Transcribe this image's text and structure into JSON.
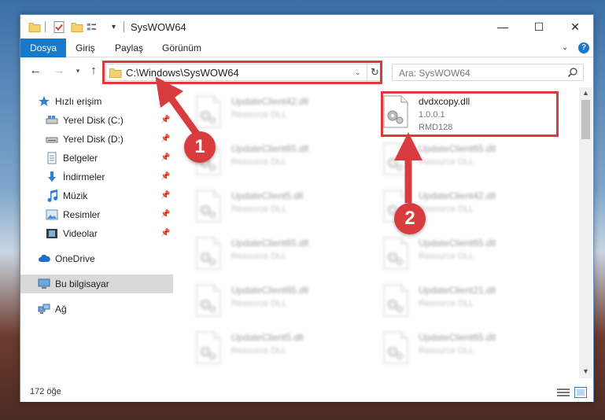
{
  "window": {
    "title": "SysWOW64",
    "minimize": "—",
    "maximize": "☐",
    "close": "✕"
  },
  "ribbon": {
    "tabs": [
      {
        "label": "Dosya"
      },
      {
        "label": "Giriş"
      },
      {
        "label": "Paylaş"
      },
      {
        "label": "Görünüm"
      }
    ],
    "help": "?"
  },
  "address": {
    "path": "C:\\Windows\\SysWOW64"
  },
  "search": {
    "placeholder": "Ara: SysWOW64"
  },
  "sidebar": {
    "items": [
      {
        "label": "Hızlı erişim",
        "icon": "star-icon"
      },
      {
        "label": "Yerel Disk (C:)",
        "icon": "drive-icon",
        "pinned": true
      },
      {
        "label": "Yerel Disk (D:)",
        "icon": "drive-icon",
        "pinned": true
      },
      {
        "label": "Belgeler",
        "icon": "documents-icon",
        "pinned": true
      },
      {
        "label": "İndirmeler",
        "icon": "download-icon",
        "pinned": true
      },
      {
        "label": "Müzik",
        "icon": "music-icon",
        "pinned": true
      },
      {
        "label": "Resimler",
        "icon": "pictures-icon",
        "pinned": true
      },
      {
        "label": "Videolar",
        "icon": "videos-icon",
        "pinned": true
      },
      {
        "label": "OneDrive",
        "icon": "cloud-icon"
      },
      {
        "label": "Bu bilgisayar",
        "icon": "computer-icon",
        "selected": true
      },
      {
        "label": "Ağ",
        "icon": "network-icon"
      }
    ]
  },
  "files": {
    "left_column": [
      {
        "name": "UpdateClient42.dll",
        "desc": "Resource DLL"
      },
      {
        "name": "UpdateClient65.dll",
        "desc": "Resource DLL"
      },
      {
        "name": "UpdateClient5.dll",
        "desc": "Resource DLL"
      },
      {
        "name": "UpdateClient65.dll",
        "desc": "Resource DLL"
      },
      {
        "name": "UpdateClient65.dll",
        "desc": "Resource DLL"
      },
      {
        "name": "UpdateClient5.dll",
        "desc": "Resource DLL"
      }
    ],
    "right_column": [
      {
        "name": "dvdxcopy.dll",
        "version": "1.0.0.1",
        "product": "RMD128",
        "highlight": true
      },
      {
        "name": "UpdateClient65.dll",
        "desc": "Resource DLL"
      },
      {
        "name": "UpdateClient42.dll",
        "desc": "Resource DLL"
      },
      {
        "name": "UpdateClient65.dll",
        "desc": "Resource DLL"
      },
      {
        "name": "UpdateClient21.dll",
        "desc": "Resource DLL"
      },
      {
        "name": "UpdateClient65.dll",
        "desc": "Resource DLL"
      }
    ]
  },
  "status": {
    "count": "172 öğe"
  },
  "annotations": {
    "badge1": "1",
    "badge2": "2",
    "color": "#d93c3e"
  }
}
